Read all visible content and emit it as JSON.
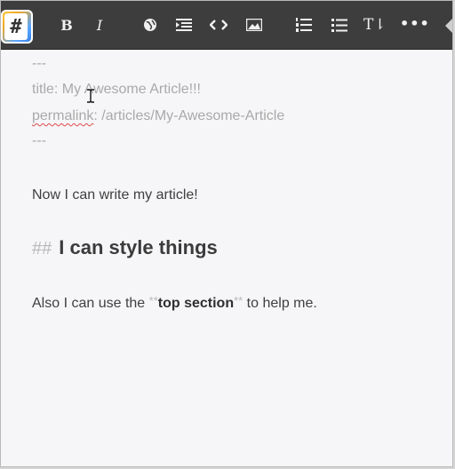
{
  "toolbar": {
    "logo_char": "#",
    "bold_label": "B",
    "italic_label": "I",
    "title_label": "T⇂",
    "more_label": "•••"
  },
  "editor": {
    "frontmatter_open": "---",
    "title_line": "title: My Awesome Article!!!",
    "permalink_key": "permalink",
    "permalink_rest": ": /articles/My-Awesome-Article",
    "frontmatter_close": "---",
    "paragraph1": "Now I can write my article!",
    "heading_marker": "##",
    "heading_text": "I can style things",
    "p2_prefix": "Also I can use the ",
    "bold_marker_open": "**",
    "bold_text": "top section",
    "bold_marker_close": "**",
    "p2_suffix": " to help me."
  },
  "icons": [
    "logo-icon",
    "bold-icon",
    "italic-icon",
    "globe-icon",
    "indent-icon",
    "code-icon",
    "image-icon",
    "ordered-list-icon",
    "bullet-list-icon",
    "text-size-icon",
    "more-icon"
  ]
}
